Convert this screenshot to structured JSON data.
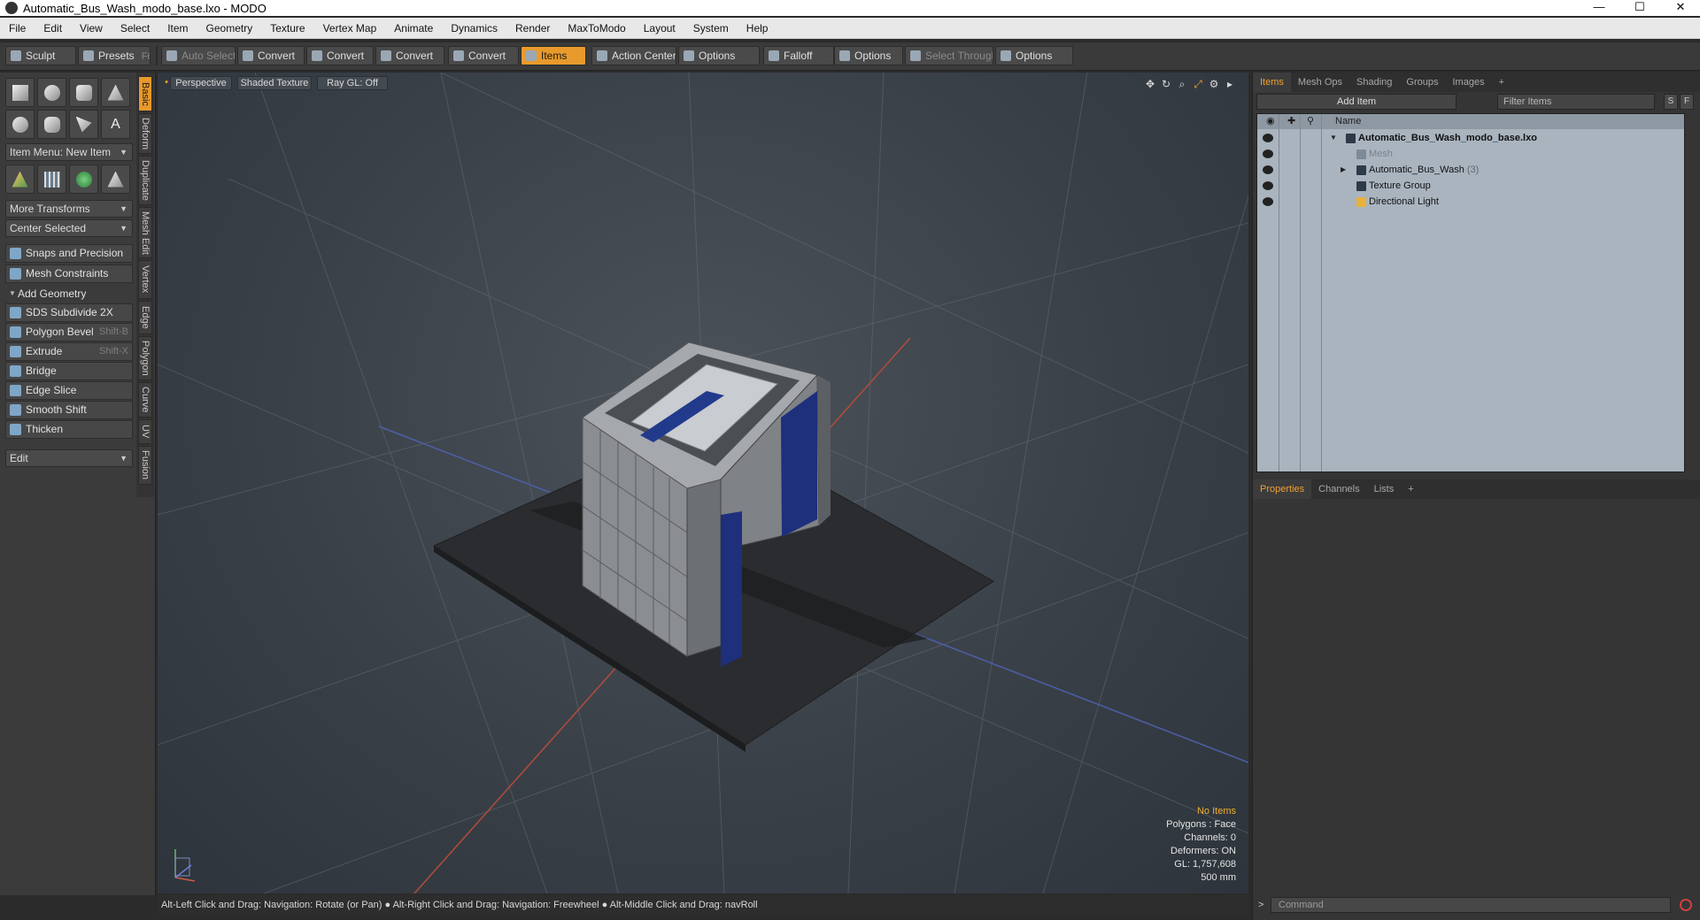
{
  "window": {
    "title": "Automatic_Bus_Wash_modo_base.lxo - MODO",
    "minimize": "—",
    "maximize": "☐",
    "close": "✕"
  },
  "menubar": [
    "File",
    "Edit",
    "View",
    "Select",
    "Item",
    "Geometry",
    "Texture",
    "Vertex Map",
    "Animate",
    "Dynamics",
    "Render",
    "MaxToModo",
    "Layout",
    "System",
    "Help"
  ],
  "toolbar": {
    "sculpt": "Sculpt",
    "presets": "Presets",
    "presets_shortcut": "F6",
    "auto_select": "Auto Select",
    "convert1": "Convert",
    "convert2": "Convert",
    "convert3": "Convert",
    "convert4": "Convert",
    "items": "Items",
    "action_center": "Action Center",
    "options1": "Options",
    "falloff": "Falloff",
    "options2": "Options",
    "select_through": "Select Through",
    "options3": "Options"
  },
  "leftpanel": {
    "item_menu": "Item Menu: New Item",
    "more_transforms": "More Transforms",
    "center_selected": "Center Selected",
    "snaps": "Snaps and Precision",
    "mesh_constraints": "Mesh Constraints",
    "add_geometry": "Add Geometry",
    "tools": [
      {
        "label": "SDS Subdivide 2X",
        "shortcut": ""
      },
      {
        "label": "Polygon Bevel",
        "shortcut": "Shift-B"
      },
      {
        "label": "Extrude",
        "shortcut": "Shift-X"
      },
      {
        "label": "Bridge",
        "shortcut": ""
      },
      {
        "label": "Edge Slice",
        "shortcut": ""
      },
      {
        "label": "Smooth Shift",
        "shortcut": ""
      },
      {
        "label": "Thicken",
        "shortcut": ""
      }
    ],
    "edit": "Edit",
    "vtabs": [
      "Basic",
      "Deform",
      "Duplicate",
      "Mesh Edit",
      "Vertex",
      "Edge",
      "Polygon",
      "Curve",
      "UV",
      "Fusion"
    ]
  },
  "viewport": {
    "view_mode": "Perspective",
    "shading": "Shaded Texture",
    "raygl": "Ray GL: Off",
    "info": {
      "selection": "No Items",
      "polygons": "Polygons : Face",
      "channels": "Channels: 0",
      "deformers": "Deformers: ON",
      "gl": "GL: 1,757,608",
      "scale": "500 mm"
    }
  },
  "statusbar": "Alt-Left Click and Drag: Navigation: Rotate (or Pan) ● Alt-Right Click and Drag: Navigation: Freewheel ● Alt-Middle Click and Drag: navRoll",
  "rightpanel": {
    "top_tabs": [
      "Items",
      "Mesh Ops",
      "Shading",
      "Groups",
      "Images",
      "+"
    ],
    "add_item": "Add Item",
    "filter_items": "Filter Items",
    "s_btn": "S",
    "f_btn": "F",
    "name_col": "Name",
    "items": [
      {
        "label": "Automatic_Bus_Wash_modo_base.lxo",
        "count": ""
      },
      {
        "label": "Mesh",
        "count": ""
      },
      {
        "label": "Automatic_Bus_Wash",
        "count": "(3)"
      },
      {
        "label": "Texture Group",
        "count": ""
      },
      {
        "label": "Directional Light",
        "count": ""
      }
    ],
    "bottom_tabs": [
      "Properties",
      "Channels",
      "Lists",
      "+"
    ],
    "command_prompt": ">",
    "command_placeholder": "Command"
  }
}
